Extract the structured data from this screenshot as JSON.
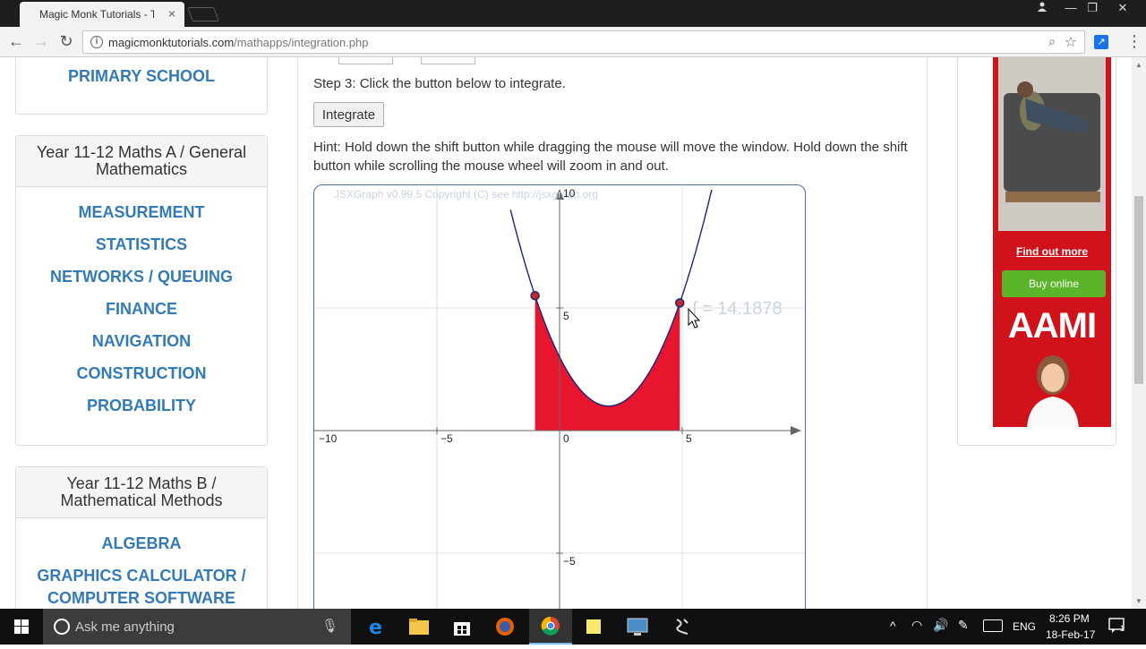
{
  "browser": {
    "tab_title": "Magic Monk Tutorials - T",
    "tab_close": "×",
    "url_domain": "magicmonktutorials.com",
    "url_path": "/mathapps/integration.php"
  },
  "sidebar": {
    "top_link": "PRIMARY SCHOOL",
    "panel_a": {
      "heading": "Year 11-12 Maths A / General Mathematics",
      "links": [
        "MEASUREMENT",
        "STATISTICS",
        "NETWORKS / QUEUING",
        "FINANCE",
        "NAVIGATION",
        "CONSTRUCTION",
        "PROBABILITY"
      ]
    },
    "panel_b": {
      "heading": "Year 11-12 Maths B / Mathematical Methods",
      "links": [
        "ALGEBRA",
        "GRAPHICS CALCULATOR / COMPUTER SOFTWARE"
      ]
    }
  },
  "main": {
    "step3": "Step 3: Click the button below to integrate.",
    "integrate_label": "Integrate",
    "hint": "Hint: Hold down the shift button while dragging the mouse will move the window. Hold down the shift button while scrolling the mouse wheel will zoom in and out."
  },
  "graph": {
    "copyright": "JSXGraph v0.99.5 Copyright (C) see http://jsxgraph.org",
    "integral_label": "∫ = 14.1878",
    "x_ticks": [
      "−10",
      "−5",
      "0",
      "5"
    ],
    "y_ticks": [
      "10",
      "5",
      "−5"
    ],
    "curve_color": "#1a237e",
    "fill_color": "#e8152f",
    "point_color": "#c62828"
  },
  "ad": {
    "find_out_more": "Find out more",
    "buy_online": "Buy online",
    "brand": "AAMI",
    "brand_color": "#d0121b"
  },
  "taskbar": {
    "search_placeholder": "Ask me anything",
    "language": "ENG",
    "time": "8:26 PM",
    "date": "18-Feb-17",
    "notification_count": "1"
  }
}
